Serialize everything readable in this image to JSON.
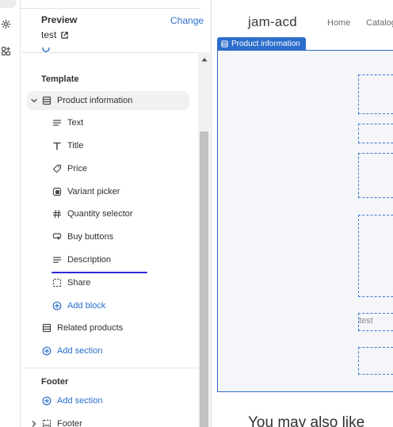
{
  "preview": {
    "label": "Preview",
    "change_label": "Change",
    "theme_name": "test"
  },
  "template": {
    "heading": "Template",
    "section": "Product information",
    "blocks": [
      {
        "label": "Text",
        "icon": "text-lines-icon"
      },
      {
        "label": "Title",
        "icon": "title-t-icon"
      },
      {
        "label": "Price",
        "icon": "price-tag-icon"
      },
      {
        "label": "Variant picker",
        "icon": "variant-picker-icon"
      },
      {
        "label": "Quantity selector",
        "icon": "hash-icon"
      },
      {
        "label": "Buy buttons",
        "icon": "cursor-button-icon"
      },
      {
        "label": "Description",
        "icon": "text-lines-icon"
      },
      {
        "label": "Share",
        "icon": "share-dashed-icon"
      }
    ],
    "add_block": "Add block",
    "related": "Related products",
    "add_section": "Add section"
  },
  "footer": {
    "heading": "Footer",
    "add_section": "Add section",
    "section": "Footer"
  },
  "store": {
    "title": "jam-acd",
    "nav": [
      "Home",
      "Catalog"
    ],
    "selected_section_tag": "Product information",
    "block_text": "test",
    "also_like": "You may also like"
  },
  "colors": {
    "accent": "#2c6ecb",
    "drop_indicator": "#2a2ad6",
    "selected_row": "#f1f1f1"
  }
}
